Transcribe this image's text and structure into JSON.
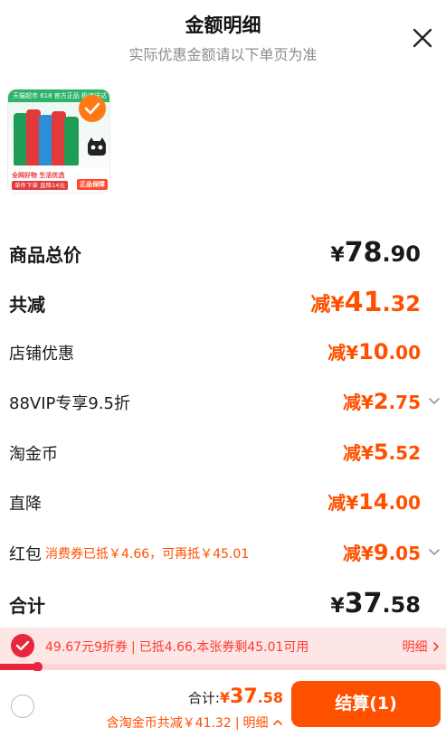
{
  "header": {
    "title": "金额明细",
    "subtitle": "实际优惠金额请以下单页为准",
    "close_icon": "close-icon"
  },
  "product": {
    "top_text": "天猫超市 618 官方正品 极速送达",
    "bar_line1": "全网好物 生活优选",
    "bar_line2": "单件下单 直降14元",
    "badge": "正品保障",
    "selected": true
  },
  "rows": {
    "goods_total": {
      "label": "商品总价",
      "yen": "¥",
      "int": "78",
      "dec": ".90"
    },
    "total_discount": {
      "label": "共减",
      "prefix": "减",
      "yen": "¥",
      "int": "41",
      "dec": ".32"
    },
    "shop_discount": {
      "label": "店铺优惠",
      "prefix": "减",
      "yen": "¥",
      "int": "10",
      "dec": ".00"
    },
    "vip": {
      "label": "88VIP专享9.5折",
      "prefix": "减",
      "yen": "¥",
      "int": "2",
      "dec": ".75"
    },
    "taojinbi": {
      "label": "淘金币",
      "prefix": "减",
      "yen": "¥",
      "int": "5",
      "dec": ".52"
    },
    "direct_cut": {
      "label": "直降",
      "prefix": "减",
      "yen": "¥",
      "int": "14",
      "dec": ".00"
    },
    "red_packet": {
      "label": "红包",
      "note": "消费券已抵￥4.66，可再抵￥45.01",
      "prefix": "减",
      "yen": "¥",
      "int": "9",
      "dec": ".05"
    },
    "sum": {
      "label": "合计",
      "yen": "¥",
      "int": "37",
      "dec": ".58"
    }
  },
  "coupon": {
    "name": "49.67元9折券",
    "status": "已抵4.66,本张券剩45.01可用",
    "detail": "明细",
    "progress_percent": 8.5
  },
  "footer": {
    "total_label": "合计:",
    "yen": "¥",
    "int": "37",
    "dec": ".58",
    "sub_note": "含淘金币共减￥41.32",
    "sub_detail": "明细",
    "checkout": "结算(1)"
  },
  "colors": {
    "accent": "#ff5000",
    "coupon_red": "#e8263d",
    "coupon_bg": "#fde6e6"
  }
}
